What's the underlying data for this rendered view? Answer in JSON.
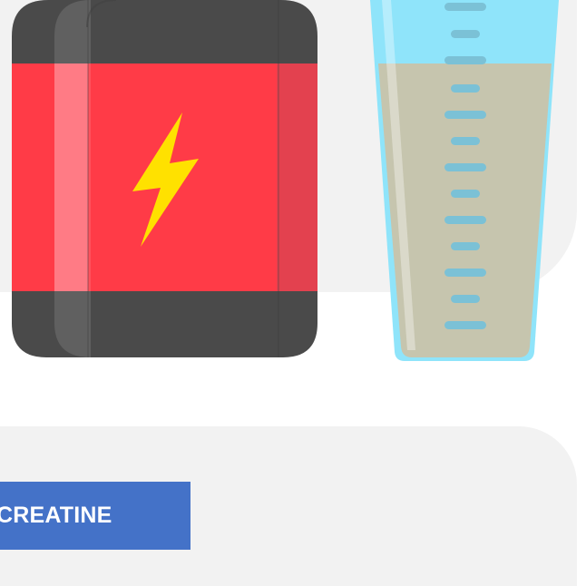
{
  "category": {
    "label": "CREATINE",
    "color": "#4472c8"
  },
  "illustration": {
    "left_icon": "supplement-tub-icon",
    "center_icon": "lightning-bolt-icon",
    "right_icon": "shaker-cup-icon"
  },
  "colors": {
    "card_background": "#f2f2f2",
    "tub_dark": "#4a4a4a",
    "tub_label": "#ff3b47",
    "bolt": "#ffe100",
    "cup_water": "#8fe4fa",
    "cup_liquid": "#c6c5ae",
    "cup_tick": "#7bc1d6"
  }
}
